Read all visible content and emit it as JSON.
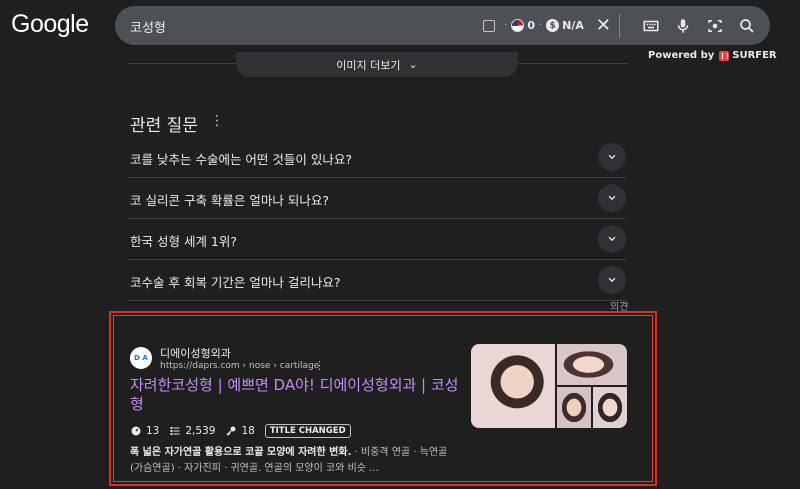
{
  "logo": "Google",
  "search": {
    "query": "코성형",
    "stat_count": "0",
    "stat_price": "N/A"
  },
  "powered": {
    "prefix": "Powered by",
    "brand": "SURFER"
  },
  "more_images": "이미지 더보기",
  "paa": {
    "title": "관련 질문",
    "questions": [
      "코를 낮추는 수술에는 어떤 것들이 있나요?",
      "코 실리콘 구축 확률은 얼마나 되나요?",
      "한국 성형 세계 1위?",
      "코수술 후 회복 기간은 얼마나 걸리나요?"
    ],
    "feedback": "의견"
  },
  "result": {
    "favicon_text": "D A",
    "site_name": "디에이성형외과",
    "url": "https://daprs.com › nose › cartilage",
    "title": "자려한코성형 | 예쁘면 DA야! 디에이성형외과 | 코성형",
    "metrics": {
      "m1": "13",
      "m2": "2,539",
      "m3": "18",
      "tag": "TITLE CHANGED"
    },
    "snippet_bold": "폭 넓은 자가연골 활용으로 코끝 모양에 자려한 변화.",
    "snippet_rest": " · 비중격 연골 · 늑연골 (가슴연골) · 자가진피 · 귀연골. 연골의 모양이 코와 비슷 ..."
  }
}
